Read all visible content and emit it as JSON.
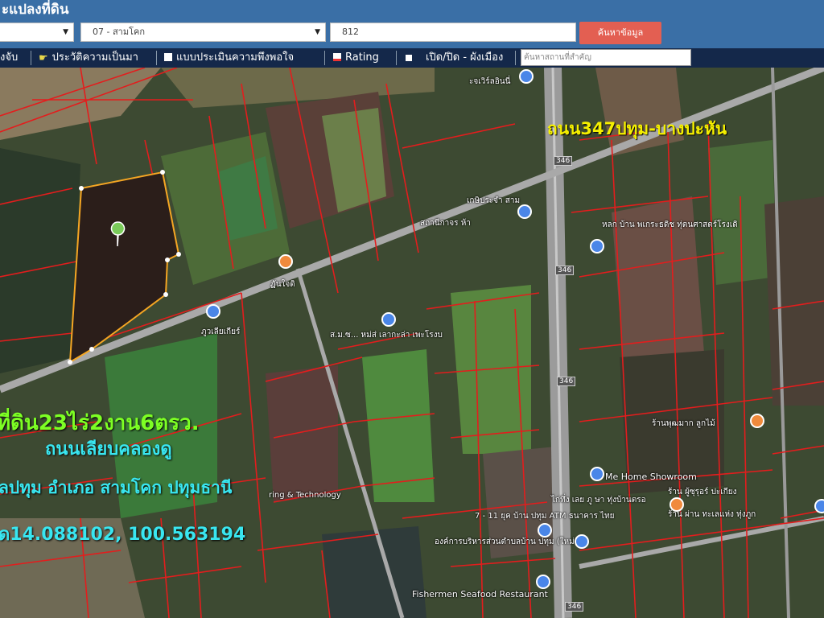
{
  "header": {
    "title": "ะแปลงที่ดิน",
    "province_select": "",
    "district_select": "07 - สามโคก",
    "parcel_input": "812",
    "search_button": "ค้นหาข้อมูล"
  },
  "toolbar": {
    "item_1": "งจับ",
    "item_2": "ประวัติความเป็นมา",
    "item_3": "แบบประเมินความพึงพอใจ",
    "item_4": "Rating",
    "item_5": "เปิด/ปิด - ผังเมือง",
    "search_placeholder": "ค้นหาสถานที่สำคัญ",
    "icons": [
      "pointer-icon",
      "document-icon",
      "rating-icon",
      "toggle-icon"
    ]
  },
  "map": {
    "road_label": "ถนน347ปทุม-บางปะหัน",
    "area_label": "ที่ดิน23ไร่2งาน6ตรว.",
    "street_label": "ถนนเลียบคลองดู",
    "address_label": "ุลปทุม อำเภอ สามโคก ปทุมธานี",
    "coordinates_label": "ด14.088102, 100.563194",
    "places": {
      "p1": "ะจเวิร์ลอินนี่",
      "p2": "เกษิประจำ สาม",
      "p3": "ส.ม.ซ... หม่ส่ เลากะล่า เพะโรงบ",
      "p4": "หลก บ้าน พเกระธดิช ทุ่ตนศาสตร์โรงเดิ",
      "p5": "ฏันใจดิ",
      "p6": "ภูวเลียเกียร์",
      "p7": "ไก่ทึ่ง เลย ภู ษา ทุ่งบ้านตรอ",
      "p8": "ring & Technology",
      "p9": "Me Home Showroom",
      "p10": "7 - 11 ยุค บ้าน ปทุม ATM ธนาคาร ไทย",
      "p11": "สถานีกาจร ห้า",
      "p12": "องค์การบริหารส่วนตำบลบ้าน ปทุม (ใหม่)",
      "p13": "Fishermen Seafood Restaurant",
      "p14": "ร้านพุฒมาก ลูกไม้",
      "p15": "ร้าน ผู้ซุรุอร์ ปะเกียง",
      "p16": "ร้าน ผ่าน ทะเลแห่ง ทุ่งภูก"
    },
    "road_shields": [
      "346",
      "346",
      "346",
      "346"
    ],
    "colors": {
      "header_bg": "#3a6fa6",
      "toolbar_bg": "#14284a",
      "button_bg": "#e35f52",
      "parcel_lines": "#e31d1d",
      "plot_outline": "#f5a623"
    }
  }
}
